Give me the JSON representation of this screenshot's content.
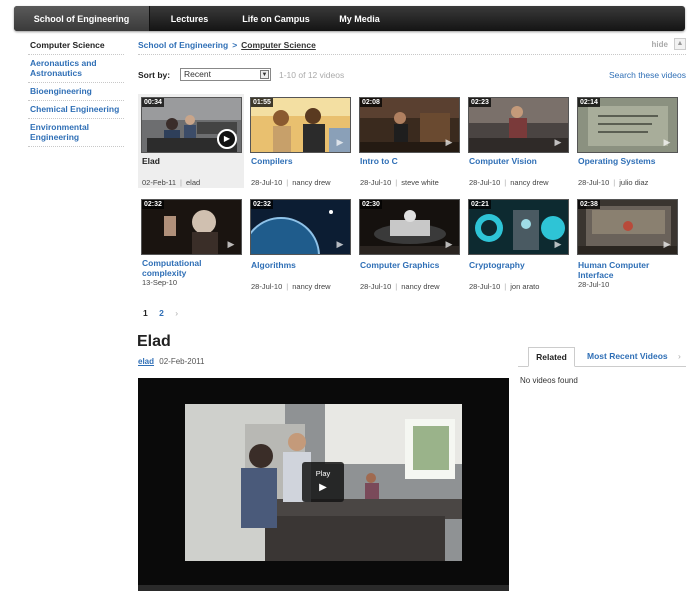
{
  "topnav": {
    "tabs": [
      "School of Engineering",
      "Lectures",
      "Life on Campus",
      "My Media"
    ]
  },
  "sidebar": {
    "items": [
      "Computer Science",
      "Aeronautics and Astronautics",
      "Bioengineering",
      "Chemical Engineering",
      "Environmental Engineering"
    ]
  },
  "breadcrumb": {
    "parent": "School of Engineering",
    "separator": ">",
    "current": "Computer Science",
    "hide_label": "hide"
  },
  "sort": {
    "label": "Sort by:",
    "selected": "Recent",
    "count_text": "1-10 of 12 videos",
    "search_link": "Search these videos"
  },
  "videos": [
    {
      "duration": "00:34",
      "title": "Elad",
      "date": "02-Feb-11",
      "author": "elad",
      "active": true
    },
    {
      "duration": "01:55",
      "title": "Compilers",
      "date": "28-Jul-10",
      "author": "nancy drew"
    },
    {
      "duration": "02:08",
      "title": "Intro to C",
      "date": "28-Jul-10",
      "author": "steve white"
    },
    {
      "duration": "02:23",
      "title": "Computer Vision",
      "date": "28-Jul-10",
      "author": "nancy drew"
    },
    {
      "duration": "02:14",
      "title": "Operating Systems",
      "date": "28-Jul-10",
      "author": "julio diaz"
    },
    {
      "duration": "02:32",
      "title": "Computational complexity",
      "date": "13-Sep-10",
      "author": ""
    },
    {
      "duration": "02:32",
      "title": "Algorithms",
      "date": "28-Jul-10",
      "author": "nancy drew"
    },
    {
      "duration": "02:30",
      "title": "Computer Graphics",
      "date": "28-Jul-10",
      "author": "nancy drew"
    },
    {
      "duration": "02:21",
      "title": "Cryptography",
      "date": "28-Jul-10",
      "author": "jon arato"
    },
    {
      "duration": "02:38",
      "title": "Human Computer Interface",
      "date": "28-Jul-10",
      "author": ""
    }
  ],
  "pager": {
    "current": "1",
    "pages": [
      "2"
    ],
    "next_glyph": "›"
  },
  "detail": {
    "title": "Elad",
    "author": "elad",
    "date": "02-Feb-2011",
    "play_label": "Play",
    "play_glyph": "▶"
  },
  "related": {
    "tabs": [
      "Related",
      "Most Recent Videos",
      "›"
    ],
    "empty_text": "No videos found"
  },
  "colors": {
    "link": "#2f6fb6",
    "nav_bg": "#1e1e1e",
    "player_bg": "#0a0a0a"
  }
}
